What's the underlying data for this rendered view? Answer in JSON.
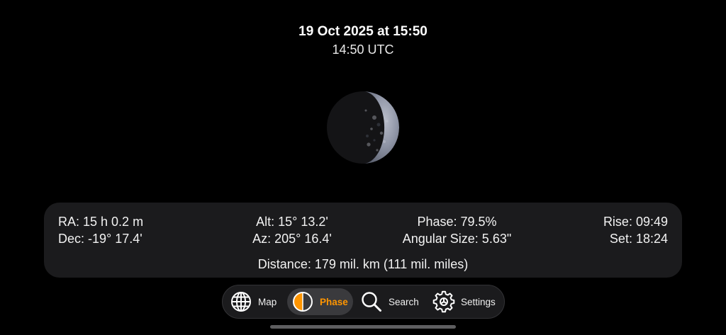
{
  "header": {
    "local_time": "19 Oct 2025 at 15:50",
    "utc_time": "14:50 UTC"
  },
  "info": {
    "ra": "RA: 15 h 0.2 m",
    "dec": "Dec: -19° 17.4'",
    "alt": "Alt: 15° 13.2'",
    "az": "Az: 205° 16.4'",
    "phase": "Phase: 79.5%",
    "angular_size": "Angular Size: 5.63\"",
    "rise": "Rise: 09:49",
    "set": "Set: 18:24",
    "distance": "Distance: 179 mil. km (111 mil. miles)"
  },
  "phase_fraction": 0.795,
  "tabs": [
    {
      "label": "Map",
      "icon": "globe-icon",
      "active": false
    },
    {
      "label": "Phase",
      "icon": "half-circle-icon",
      "active": true
    },
    {
      "label": "Search",
      "icon": "magnifier-icon",
      "active": false
    },
    {
      "label": "Settings",
      "icon": "gear-icon",
      "active": false
    }
  ],
  "colors": {
    "accent": "#ff9500",
    "panel": "#1b1b1d",
    "background": "#000000"
  }
}
